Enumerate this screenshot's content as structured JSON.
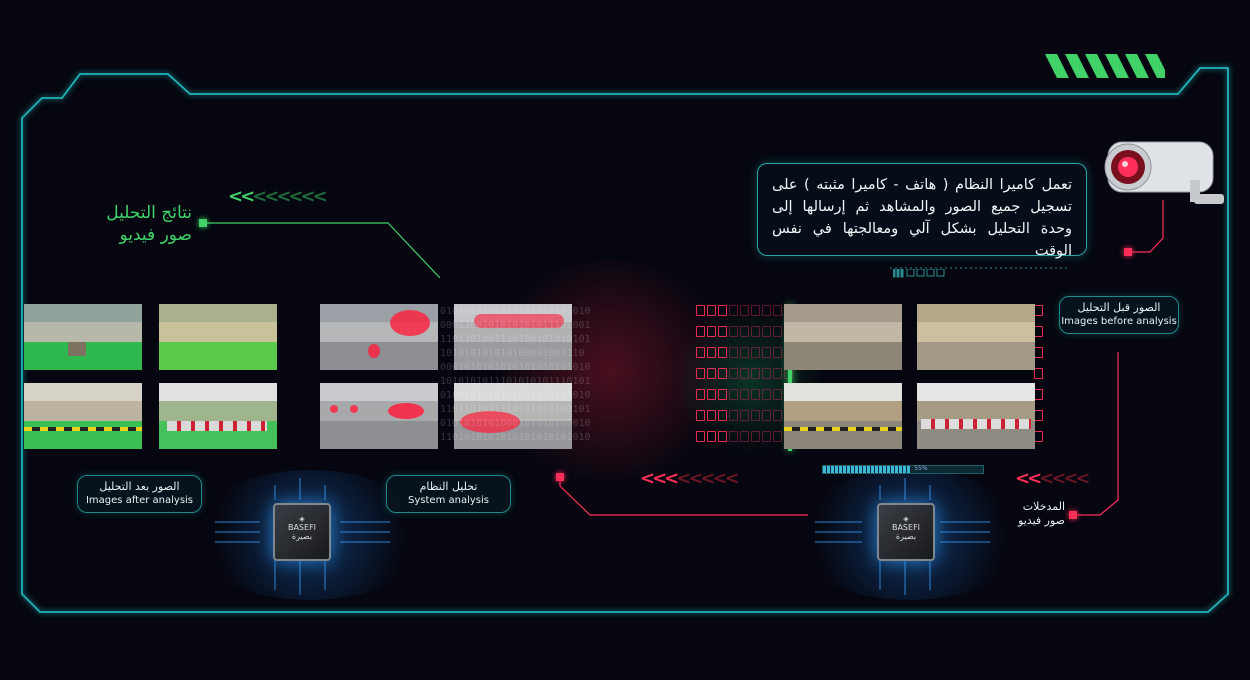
{
  "colors": {
    "cyan": "#1fb3b8",
    "green": "#41d36a",
    "red": "#ff2f5a",
    "background": "#05060f"
  },
  "description": {
    "text": "تعمل كاميرا النظام ( هاتف - كاميرا مثبته ) على تسجيل جميع الصور والمشاهد ثم إرسالها إلى وحدة التحليل بشكل آلي ومعالجتها في نفس الوقت"
  },
  "results_title": {
    "line1": "نتائج التحليل",
    "line2": "صور فيديو"
  },
  "labels": {
    "before": {
      "ar": "الصور قبل التحليل",
      "en": "Images before analysis"
    },
    "after": {
      "ar": "الصور بعد التحليل",
      "en": "Images after analysis"
    },
    "system": {
      "ar": "تحليل النظام",
      "en": "System analysis"
    },
    "inputs": {
      "line1": "المدخلات",
      "line2": "صور فيديو"
    }
  },
  "progress": {
    "value": 0.55,
    "label": "55%"
  },
  "chips": [
    {
      "brand": "BASEFI",
      "brand_ar": "بصيرة"
    },
    {
      "brand": "BASEFI",
      "brand_ar": "بصيرة"
    }
  ],
  "icons": [
    "camera-icon",
    "chip-icon",
    "chevron-left-icon",
    "stripes-icon"
  ]
}
